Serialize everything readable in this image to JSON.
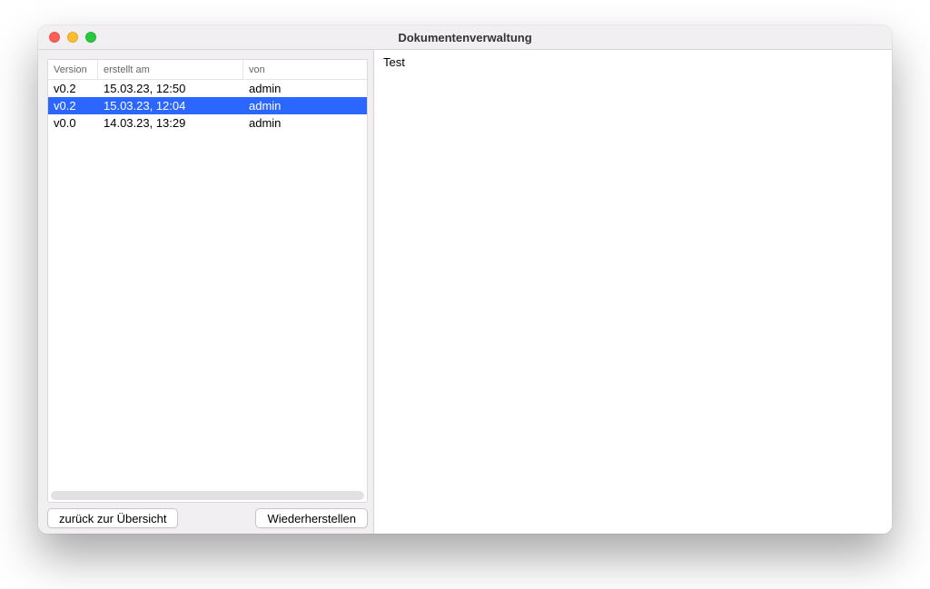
{
  "window": {
    "title": "Dokumentenverwaltung"
  },
  "table": {
    "headers": {
      "version": "Version",
      "created": "erstellt am",
      "by": "von"
    },
    "rows": [
      {
        "version": "v0.2",
        "created": "15.03.23, 12:50",
        "by": "admin",
        "selected": false
      },
      {
        "version": "v0.2",
        "created": "15.03.23, 12:04",
        "by": "admin",
        "selected": true
      },
      {
        "version": "v0.0",
        "created": "14.03.23, 13:29",
        "by": "admin",
        "selected": false
      }
    ]
  },
  "buttons": {
    "back": "zurück zur Übersicht",
    "restore": "Wiederherstellen"
  },
  "preview": {
    "text": "Test"
  }
}
